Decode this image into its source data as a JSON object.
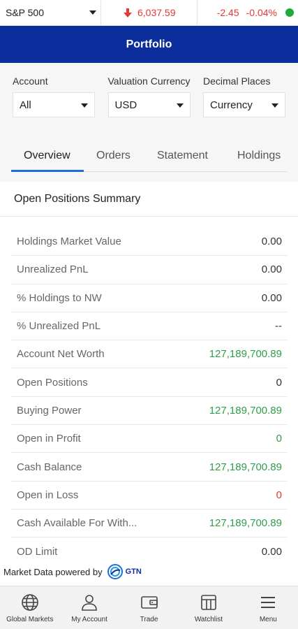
{
  "ticker": {
    "index_name": "S&P 500",
    "price": "6,037.59",
    "change": "-2.45",
    "change_pct": "-0.04%",
    "down_color": "#e53935",
    "status_color": "#1faa3a"
  },
  "header": {
    "title": "Portfolio",
    "background": "#0c2d9c"
  },
  "filters": [
    {
      "label": "Account",
      "value": "All"
    },
    {
      "label": "Valuation Currency",
      "value": "USD"
    },
    {
      "label": "Decimal Places",
      "value": "Currency"
    }
  ],
  "tabs": [
    {
      "label": "Overview",
      "active": true
    },
    {
      "label": "Orders"
    },
    {
      "label": "Statement"
    },
    {
      "label": "Holdings"
    }
  ],
  "summary": {
    "title": "Open Positions Summary",
    "rows": [
      {
        "label": "Holdings Market Value",
        "value": "0.00",
        "tone": "neutral"
      },
      {
        "label": "Unrealized PnL",
        "value": "0.00",
        "tone": "neutral"
      },
      {
        "label": "% Holdings to NW",
        "value": "0.00",
        "tone": "neutral"
      },
      {
        "label": "% Unrealized PnL",
        "value": "--",
        "tone": "neutral"
      },
      {
        "label": "Account Net Worth",
        "value": "127,189,700.89",
        "tone": "positive"
      },
      {
        "label": "Open Positions",
        "value": "0",
        "tone": "neutral"
      },
      {
        "label": "Buying Power",
        "value": "127,189,700.89",
        "tone": "positive"
      },
      {
        "label": "Open in Profit",
        "value": "0",
        "tone": "positive"
      },
      {
        "label": "Cash Balance",
        "value": "127,189,700.89",
        "tone": "positive"
      },
      {
        "label": "Open in Loss",
        "value": "0",
        "tone": "negative"
      },
      {
        "label": "Cash Available For With...",
        "value": "127,189,700.89",
        "tone": "positive"
      },
      {
        "label": "OD Limit",
        "value": "0.00",
        "tone": "neutral"
      }
    ]
  },
  "powered": {
    "text": "Market Data powered by",
    "logo_text": "GTN"
  },
  "bottom_nav": [
    {
      "label": "Global Markets",
      "icon": "globe-icon"
    },
    {
      "label": "My Account",
      "icon": "user-icon"
    },
    {
      "label": "Trade",
      "icon": "wallet-icon"
    },
    {
      "label": "Watchlist",
      "icon": "watchlist-icon"
    },
    {
      "label": "Menu",
      "icon": "menu-icon"
    }
  ]
}
